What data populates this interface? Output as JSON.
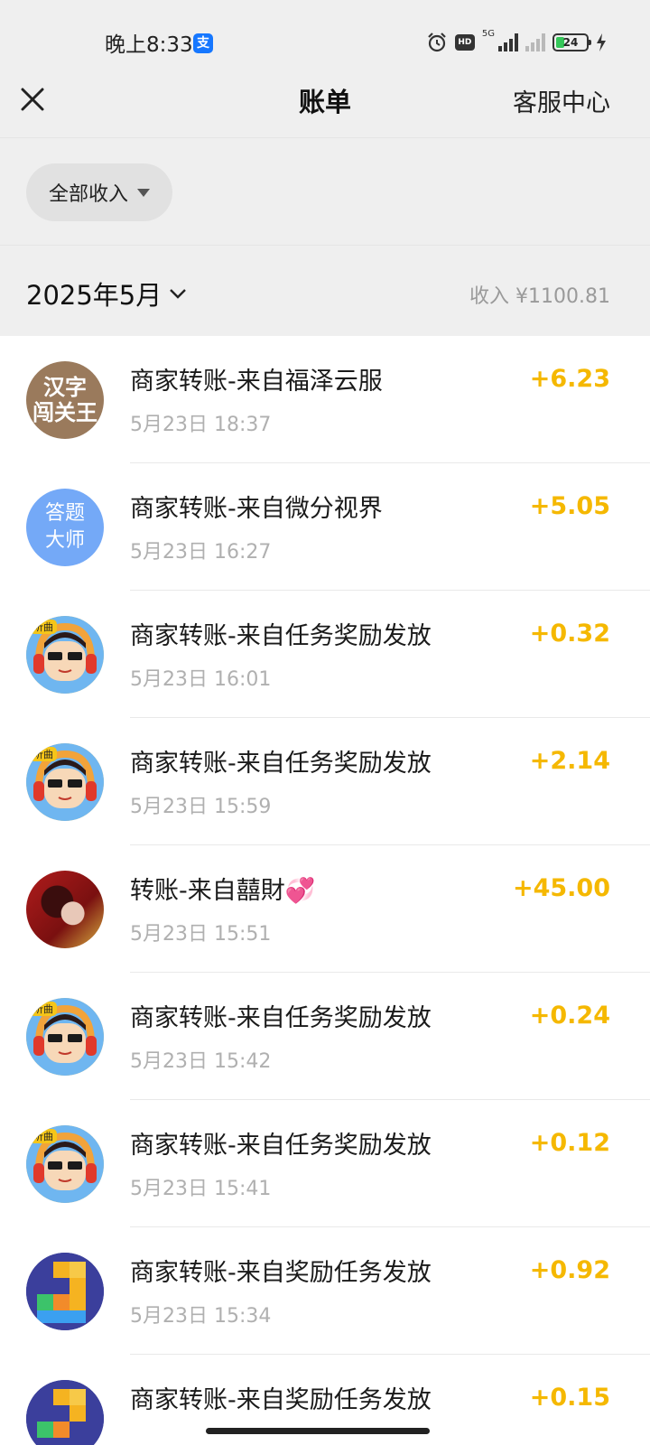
{
  "status_bar": {
    "time": "晚上8:33",
    "app_badge": "支",
    "hd_label": "HD",
    "network_label": "5G",
    "battery_level": "24"
  },
  "nav": {
    "title": "账单",
    "action": "客服中心"
  },
  "filter": {
    "label": "全部收入"
  },
  "month": {
    "label": "2025年5月",
    "income": "收入 ¥1100.81"
  },
  "colors": {
    "amount": "#f5b800",
    "accent_blue": "#1677ff"
  },
  "transactions": [
    {
      "title": "商家转账-来自福泽云服",
      "time": "5月23日 18:37",
      "amount": "+6.23",
      "avatar_icon": "hanzi-game-avatar",
      "avatar_text": [
        "汉字",
        "闯关王"
      ]
    },
    {
      "title": "商家转账-来自微分视界",
      "time": "5月23日 16:27",
      "amount": "+5.05",
      "avatar_icon": "quiz-master-avatar",
      "avatar_text": [
        "答题",
        "大师"
      ]
    },
    {
      "title": "商家转账-来自任务奖励发放",
      "time": "5月23日 16:01",
      "amount": "+0.32",
      "avatar_icon": "music-girl-avatar",
      "avatar_text": [
        "听曲"
      ]
    },
    {
      "title": "商家转账-来自任务奖励发放",
      "time": "5月23日 15:59",
      "amount": "+2.14",
      "avatar_icon": "music-girl-avatar",
      "avatar_text": [
        "听曲"
      ]
    },
    {
      "title": "转账-来自囍財💞",
      "time": "5月23日 15:51",
      "amount": "+45.00",
      "avatar_icon": "photo-avatar",
      "avatar_text": []
    },
    {
      "title": "商家转账-来自任务奖励发放",
      "time": "5月23日 15:42",
      "amount": "+0.24",
      "avatar_icon": "music-girl-avatar",
      "avatar_text": [
        "听曲"
      ]
    },
    {
      "title": "商家转账-来自任务奖励发放",
      "time": "5月23日 15:41",
      "amount": "+0.12",
      "avatar_icon": "music-girl-avatar",
      "avatar_text": [
        "听曲"
      ]
    },
    {
      "title": "商家转账-来自奖励任务发放",
      "time": "5月23日 15:34",
      "amount": "+0.92",
      "avatar_icon": "block-puzzle-avatar",
      "avatar_text": []
    },
    {
      "title": "商家转账-来自奖励任务发放",
      "time": "",
      "amount": "+0.15",
      "avatar_icon": "block-puzzle-avatar",
      "avatar_text": []
    }
  ]
}
